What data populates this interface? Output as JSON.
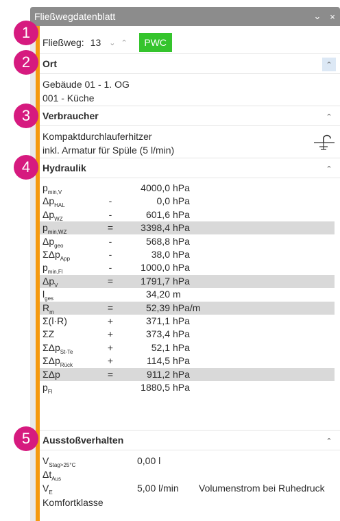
{
  "window": {
    "title": "Fließwegdatenblatt",
    "chevron": "⌄",
    "close": "×"
  },
  "selector": {
    "label": "Fließweg:",
    "value": "13",
    "down": "⌄",
    "up": "⌃",
    "button": "PWC"
  },
  "badges": [
    "1",
    "2",
    "3",
    "4",
    "5"
  ],
  "ort": {
    "title": "Ort",
    "lines": [
      "Gebäude 01 - 1. OG",
      "001 - Küche"
    ]
  },
  "verbraucher": {
    "title": "Verbraucher",
    "lines": [
      "Kompaktdurchlauferhitzer",
      "inkl. Armatur für Spüle (5 l/min)"
    ]
  },
  "hydraulik": {
    "title": "Hydraulik",
    "rows": [
      {
        "sym": "p",
        "sub": "min,V",
        "op": "",
        "val": "4000,0",
        "unit": "hPa",
        "hl": false
      },
      {
        "sym": "Δp",
        "sub": "HAL",
        "op": "-",
        "val": "0,0",
        "unit": "hPa",
        "hl": false
      },
      {
        "sym": "Δp",
        "sub": "WZ",
        "op": "-",
        "val": "601,6",
        "unit": "hPa",
        "hl": false
      },
      {
        "sym": "p",
        "sub": "min,WZ",
        "op": "=",
        "val": "3398,4",
        "unit": "hPa",
        "hl": true
      },
      {
        "sym": "Δp",
        "sub": "geo",
        "op": "-",
        "val": "568,8",
        "unit": "hPa",
        "hl": false
      },
      {
        "sym": "ΣΔp",
        "sub": "App",
        "op": "-",
        "val": "38,0",
        "unit": "hPa",
        "hl": false
      },
      {
        "sym": "p",
        "sub": "min,Fl",
        "op": "-",
        "val": "1000,0",
        "unit": "hPa",
        "hl": false
      },
      {
        "sym": "Δp",
        "sub": "V",
        "op": "=",
        "val": "1791,7",
        "unit": "hPa",
        "hl": true
      },
      {
        "sym": "l",
        "sub": "ges",
        "op": "",
        "val": "34,20",
        "unit": "m",
        "hl": false
      },
      {
        "sym": "R",
        "sub": "m",
        "op": "=",
        "val": "52,39",
        "unit": "hPa/m",
        "hl": true
      },
      {
        "sym": "Σ(l·R)",
        "sub": "",
        "op": "+",
        "val": "371,1",
        "unit": "hPa",
        "hl": false
      },
      {
        "sym": "ΣZ",
        "sub": "",
        "op": "+",
        "val": "373,4",
        "unit": "hPa",
        "hl": false
      },
      {
        "sym": "ΣΔp",
        "sub": "St-Te",
        "op": "+",
        "val": "52,1",
        "unit": "hPa",
        "hl": false
      },
      {
        "sym": "ΣΔp",
        "sub": "Rück",
        "op": "+",
        "val": "114,5",
        "unit": "hPa",
        "hl": false
      },
      {
        "sym": "ΣΔp",
        "sub": "",
        "op": "=",
        "val": "911,2",
        "unit": "hPa",
        "hl": true
      },
      {
        "sym": "p",
        "sub": "Fl",
        "op": "",
        "val": "1880,5",
        "unit": "hPa",
        "hl": false
      }
    ]
  },
  "ausstoss": {
    "title": "Ausstoßverhalten",
    "rows": [
      {
        "sym": "V",
        "sub": "Stag>25°C",
        "val": "0,00 l",
        "desc": ""
      },
      {
        "sym": "Δt",
        "sub": "Aus",
        "val": "",
        "desc": ""
      },
      {
        "sym": "V",
        "sub": "E",
        "val": "5,00 l/min",
        "desc": "Volumenstrom bei Ruhedruck"
      },
      {
        "sym": "Komfortklasse",
        "sub": "",
        "val": "",
        "desc": ""
      }
    ]
  },
  "icons": {
    "collapse": "chevron-up-icon",
    "faucet": "faucet-icon"
  }
}
